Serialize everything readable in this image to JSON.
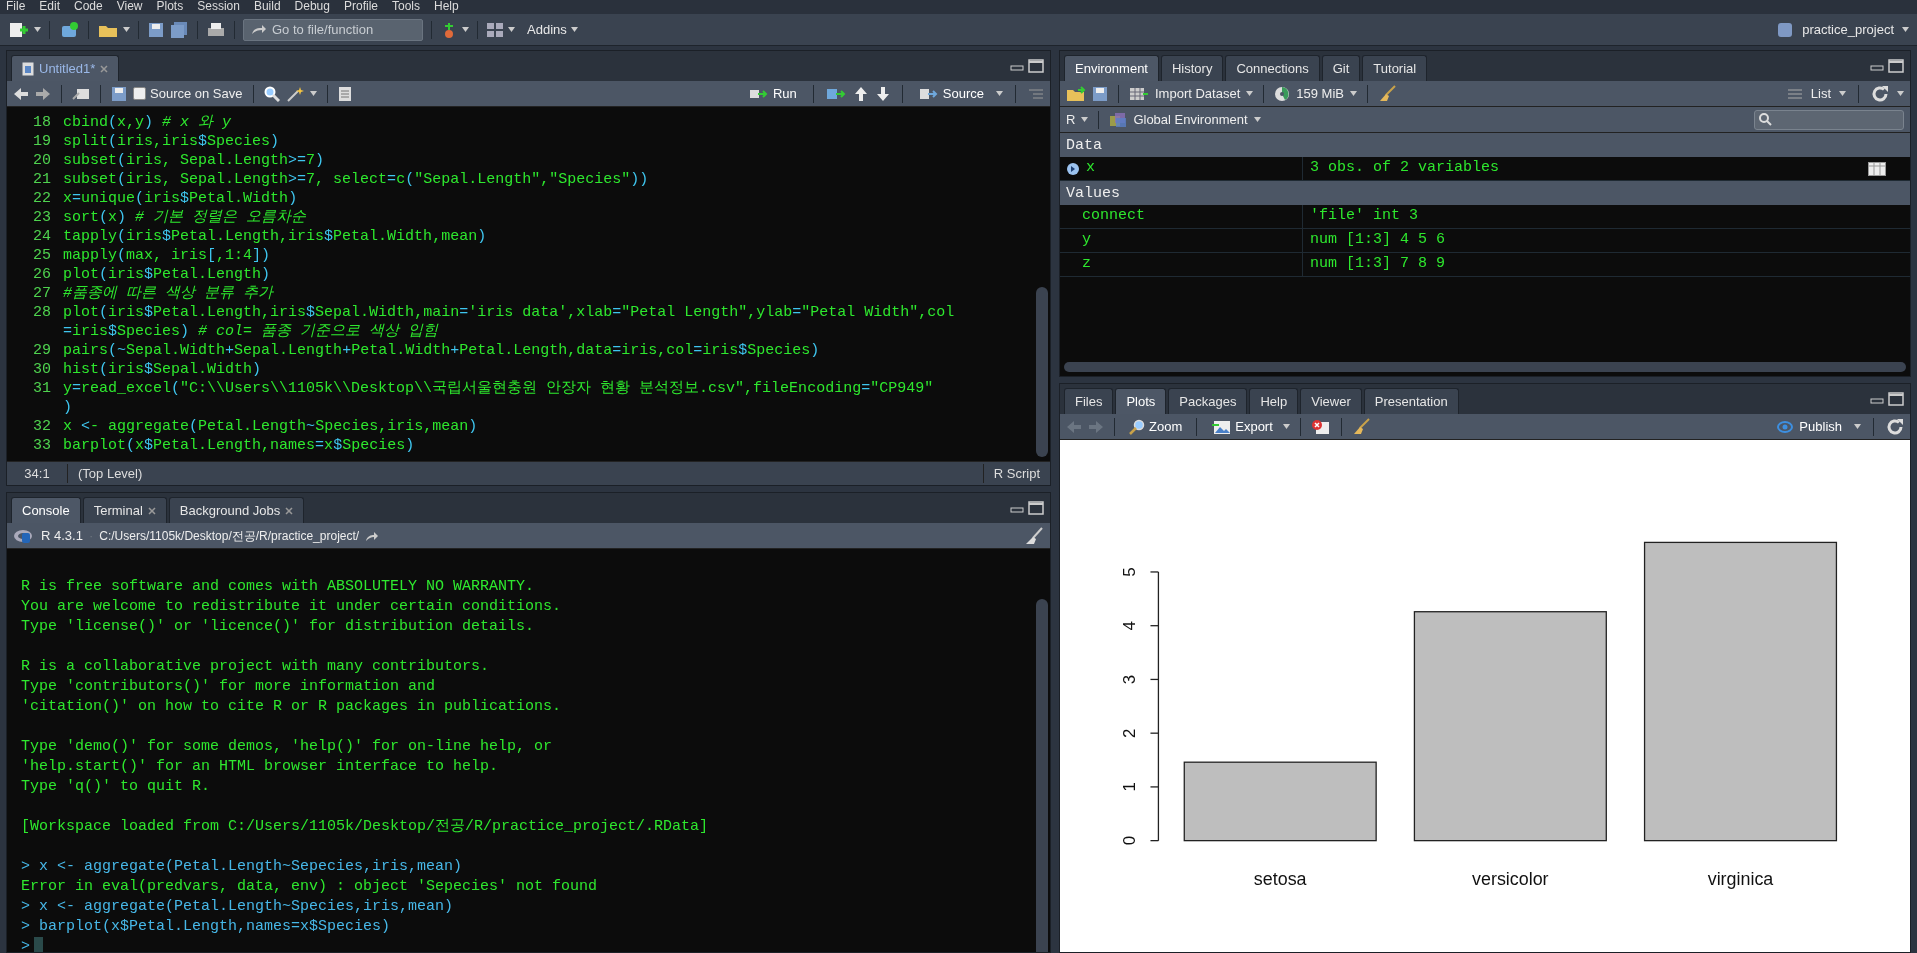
{
  "menu": [
    "File",
    "Edit",
    "Code",
    "View",
    "Plots",
    "Session",
    "Build",
    "Debug",
    "Profile",
    "Tools",
    "Help"
  ],
  "toolbar": {
    "goto_placeholder": "Go to file/function",
    "addins": "Addins",
    "project": "practice_project"
  },
  "editor": {
    "tabs": [
      {
        "label": "Untitled1*",
        "selected": true,
        "closable": true
      }
    ],
    "source_on_save": {
      "label": "Source on Save",
      "checked": false
    },
    "run": "Run",
    "source": "Source",
    "lines": [
      {
        "number": "18",
        "text": "cbind(x,y) # x 와 y"
      },
      {
        "number": "19",
        "text": "split(iris,iris$Species)"
      },
      {
        "number": "20",
        "text": "subset(iris, Sepal.Length>=7)"
      },
      {
        "number": "21",
        "text": "subset(iris, Sepal.Length>=7, select=c(\"Sepal.Length\",\"Species\"))"
      },
      {
        "number": "22",
        "text": "x=unique(iris$Petal.Width)"
      },
      {
        "number": "23",
        "text": "sort(x) # 기본 정렬은 오름차순"
      },
      {
        "number": "24",
        "text": "tapply(iris$Petal.Length,iris$Petal.Width,mean)"
      },
      {
        "number": "25",
        "text": "mapply(max, iris[,1:4])"
      },
      {
        "number": "26",
        "text": "plot(iris$Petal.Length)"
      },
      {
        "number": "27",
        "text": "#품종에 따른 색상 분류 추가"
      },
      {
        "number": "28",
        "text": "plot(iris$Petal.Length,iris$Sepal.Width,main='iris data',xlab=\"Petal Length\",ylab=\"Petal Width\",col",
        "continuation": "=iris$Species) # col= 품종 기준으로 색상 입힘"
      },
      {
        "number": "29",
        "text": "pairs(~Sepal.Width+Sepal.Length+Petal.Width+Petal.Length,data=iris,col=iris$Species)"
      },
      {
        "number": "30",
        "text": "hist(iris$Sepal.Width)"
      },
      {
        "number": "31",
        "text": "y=read_excel(\"C:\\\\Users\\\\1105k\\\\Desktop\\\\국립서울현충원 안장자 현황 분석정보.csv\",fileEncoding=\"CP949\"",
        "continuation": ")"
      },
      {
        "number": "32",
        "text": "x <- aggregate(Petal.Length~Species,iris,mean)"
      },
      {
        "number": "33",
        "text": "barplot(x$Petal.Length,names=x$Species)"
      }
    ],
    "status": {
      "position": "34:1",
      "scope": "(Top Level)",
      "file_type": "R Script"
    }
  },
  "console": {
    "tabs": [
      {
        "label": "Console",
        "selected": true,
        "closable": false
      },
      {
        "label": "Terminal",
        "selected": false,
        "closable": true
      },
      {
        "label": "Background Jobs",
        "selected": false,
        "closable": true
      }
    ],
    "version": "R 4.3.1",
    "separator": "·",
    "path": "C:/Users/1105k/Desktop/전공/R/practice_project/",
    "lines": [
      {
        "kind": "output",
        "text": "R is free software and comes with ABSOLUTELY NO WARRANTY."
      },
      {
        "kind": "output",
        "text": "You are welcome to redistribute it under certain conditions."
      },
      {
        "kind": "output",
        "text": "Type 'license()' or 'licence()' for distribution details."
      },
      {
        "kind": "blank"
      },
      {
        "kind": "output",
        "text": "R is a collaborative project with many contributors."
      },
      {
        "kind": "output",
        "text": "Type 'contributors()' for more information and"
      },
      {
        "kind": "output",
        "text": "'citation()' on how to cite R or R packages in publications."
      },
      {
        "kind": "blank"
      },
      {
        "kind": "output",
        "text": "Type 'demo()' for some demos, 'help()' for on-line help, or"
      },
      {
        "kind": "output",
        "text": "'help.start()' for an HTML browser interface to help."
      },
      {
        "kind": "output",
        "text": "Type 'q()' to quit R."
      },
      {
        "kind": "blank"
      },
      {
        "kind": "output",
        "text": "[Workspace loaded from C:/Users/1105k/Desktop/전공/R/practice_project/.RData]"
      },
      {
        "kind": "blank"
      },
      {
        "kind": "input",
        "text": "> x <- aggregate(Petal.Length~Sepecies,iris,mean)"
      },
      {
        "kind": "output",
        "text": "Error in eval(predvars, data, env) : object 'Sepecies' not found"
      },
      {
        "kind": "input",
        "text": "> x <- aggregate(Petal.Length~Species,iris,mean)"
      },
      {
        "kind": "input",
        "text": "> barplot(x$Petal.Length,names=x$Species)"
      },
      {
        "kind": "prompt",
        "text": ">"
      }
    ]
  },
  "environment": {
    "tabs": [
      {
        "label": "Environment",
        "selected": true
      },
      {
        "label": "History",
        "selected": false
      },
      {
        "label": "Connections",
        "selected": false
      },
      {
        "label": "Git",
        "selected": false
      },
      {
        "label": "Tutorial",
        "selected": false
      }
    ],
    "import_dataset": "Import Dataset",
    "memory": "159 MiB",
    "view_mode": "List",
    "language": "R",
    "scope": "Global Environment",
    "sections": [
      {
        "title": "Data",
        "rows": [
          {
            "kind": "data",
            "name": "x",
            "value": "3 obs. of 2 variables"
          }
        ]
      },
      {
        "title": "Values",
        "rows": [
          {
            "kind": "value",
            "name": "connect",
            "value": "'file' int 3"
          },
          {
            "kind": "value",
            "name": "y",
            "value": "num [1:3] 4 5 6"
          },
          {
            "kind": "value",
            "name": "z",
            "value": "num [1:3] 7 8 9"
          }
        ]
      }
    ]
  },
  "plots": {
    "tabs": [
      {
        "label": "Files",
        "selected": false
      },
      {
        "label": "Plots",
        "selected": true
      },
      {
        "label": "Packages",
        "selected": false
      },
      {
        "label": "Help",
        "selected": false
      },
      {
        "label": "Viewer",
        "selected": false
      },
      {
        "label": "Presentation",
        "selected": false
      }
    ],
    "zoom": "Zoom",
    "export": "Export",
    "publish": "Publish",
    "chart_data": {
      "type": "bar",
      "categories": [
        "setosa",
        "versicolor",
        "virginica"
      ],
      "values": [
        1.46,
        4.26,
        5.55
      ],
      "ylim": [
        0,
        5.55
      ],
      "yticks": [
        0,
        1,
        2,
        3,
        4,
        5
      ]
    }
  }
}
